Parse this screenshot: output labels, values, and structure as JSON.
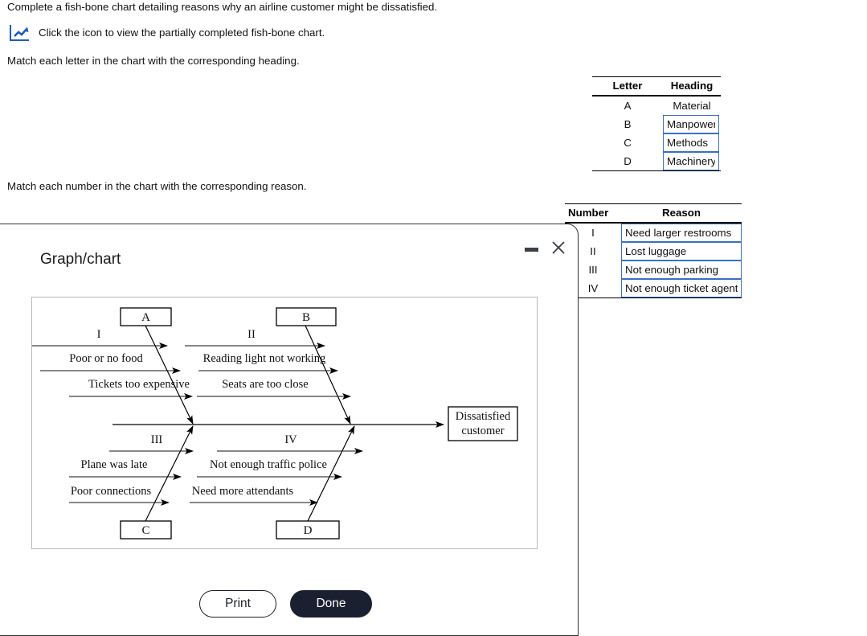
{
  "instructions": {
    "line1": "Complete a fish-bone chart detailing reasons why an airline customer might be dissatisfied.",
    "line2": "Click the icon to view the partially completed fish-bone chart.",
    "line3": "Match each letter in the chart with the corresponding heading.",
    "line4": "Match each number in the chart with the corresponding reason.",
    "icon_name": "chart-icon",
    "icon_color": "#1f5bbf"
  },
  "letter_table": {
    "headers": [
      "Letter",
      "Heading"
    ],
    "rows": [
      {
        "key": "A",
        "value": "Material",
        "editable": false
      },
      {
        "key": "B",
        "value": "Manpower",
        "editable": true
      },
      {
        "key": "C",
        "value": "Methods",
        "editable": true
      },
      {
        "key": "D",
        "value": "Machinery",
        "editable": true
      }
    ]
  },
  "number_table": {
    "headers": [
      "Number",
      "Reason"
    ],
    "rows": [
      {
        "key": "I",
        "value": "Need larger restrooms",
        "editable": true
      },
      {
        "key": "II",
        "value": "Lost luggage",
        "editable": true
      },
      {
        "key": "III",
        "value": "Not enough parking",
        "editable": true
      },
      {
        "key": "IV",
        "value": "Not enough ticket agents",
        "editable": true
      }
    ]
  },
  "modal": {
    "title": "Graph/chart",
    "minimize_label": "minimize",
    "close_label": "close",
    "buttons": {
      "print": "Print",
      "done": "Done"
    }
  },
  "chart_data": {
    "type": "diagram",
    "diagram_kind": "fishbone",
    "effect": "Dissatisfied customer",
    "categories": [
      {
        "box": "A",
        "position": "top-left",
        "causes": [
          "I",
          "Poor or no food",
          "Tickets too expensive"
        ]
      },
      {
        "box": "B",
        "position": "top-right",
        "causes": [
          "II",
          "Reading light not working",
          "Seats are too close"
        ]
      },
      {
        "box": "C",
        "position": "bottom-left",
        "causes": [
          "III",
          "Plane was late",
          "Poor connections"
        ]
      },
      {
        "box": "D",
        "position": "bottom-right",
        "causes": [
          "IV",
          "Not enough traffic police",
          "Need more attendants"
        ]
      }
    ],
    "labels": {
      "box_a": "A",
      "box_b": "B",
      "box_c": "C",
      "box_d": "D",
      "a1": "I",
      "a2": "Poor or no food",
      "a3": "Tickets too expensive",
      "b1": "II",
      "b2": "Reading light not working",
      "b3": "Seats are too close",
      "c1": "III",
      "c2": "Plane was late",
      "c3": "Poor connections",
      "d1": "IV",
      "d2": "Not enough traffic police",
      "d3": "Need more attendants",
      "effect_line1": "Dissatisfied",
      "effect_line2": "customer"
    }
  }
}
